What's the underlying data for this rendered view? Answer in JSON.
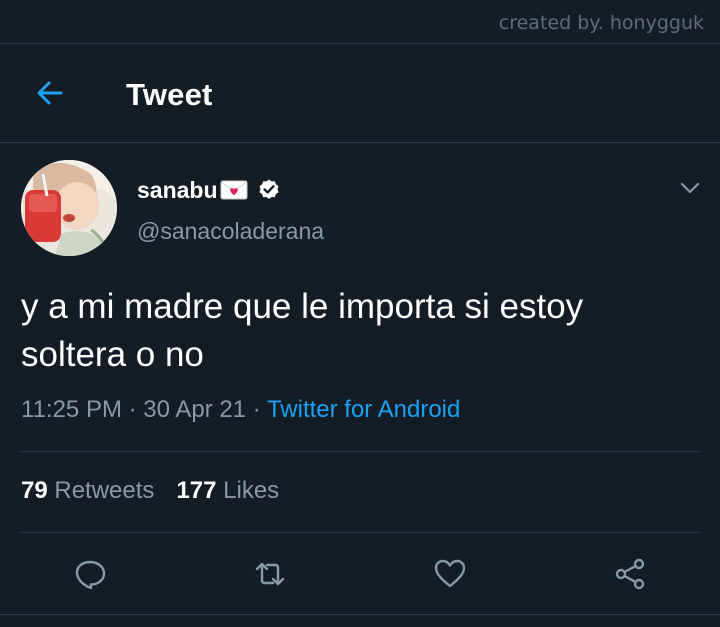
{
  "watermark": "created by. honygguk",
  "header": {
    "title": "Tweet",
    "back_icon": "arrow-left-icon"
  },
  "user": {
    "display_name": "sanabu",
    "name_emoji": "love-letter-icon",
    "verified_icon": "verified-badge-icon",
    "handle": "@sanacoladerana"
  },
  "tweet": {
    "text": "y a mi madre que le importa si estoy soltera o no",
    "time": "11:25 PM",
    "separator": " · ",
    "date": "30 Apr 21",
    "source": "Twitter for Android"
  },
  "stats": {
    "retweets_count": "79",
    "retweets_label": "Retweets",
    "likes_count": "177",
    "likes_label": "Likes"
  },
  "actions": [
    "reply-icon",
    "retweet-icon",
    "like-icon",
    "share-icon"
  ],
  "colors": {
    "background": "#141d26",
    "accent": "#1da1f2",
    "secondary_text": "#8899a6",
    "divider": "#2f3b47"
  }
}
